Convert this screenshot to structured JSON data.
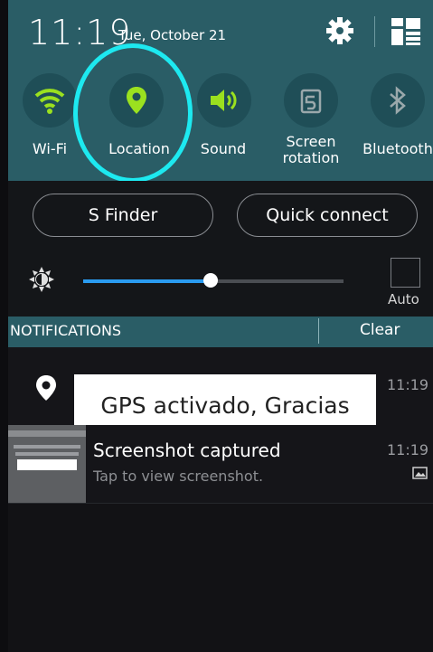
{
  "status": {
    "time": "11:19",
    "date": "Tue, October 21"
  },
  "quick_settings": [
    {
      "label": "Wi-Fi",
      "icon": "wifi-icon",
      "active": true
    },
    {
      "label": "Location",
      "icon": "location-pin-icon",
      "active": true
    },
    {
      "label": "Sound",
      "icon": "speaker-icon",
      "active": true
    },
    {
      "label_line1": "Screen",
      "label_line2": "rotation",
      "icon": "screen-rotation-icon",
      "active": false
    },
    {
      "label": "Bluetooth",
      "icon": "bluetooth-icon",
      "active": false
    }
  ],
  "buttons": {
    "s_finder": "S Finder",
    "quick_connect": "Quick connect"
  },
  "brightness": {
    "level": 0.49,
    "auto_label": "Auto"
  },
  "notifications_header": {
    "title": "NOTIFICATIONS",
    "clear": "Clear"
  },
  "notifications": [
    {
      "icon": "location-pin-icon",
      "toast": "GPS activado, Gracias",
      "time": "11:19"
    },
    {
      "title": "Screenshot captured",
      "subtitle": "Tap to view screenshot.",
      "time": "11:19",
      "icon": "image-icon"
    }
  ],
  "colors": {
    "accent": "#9be11f",
    "highlight_ring": "#1de9f0",
    "panel": "#2a5d66",
    "slider": "#2a9bf0"
  }
}
